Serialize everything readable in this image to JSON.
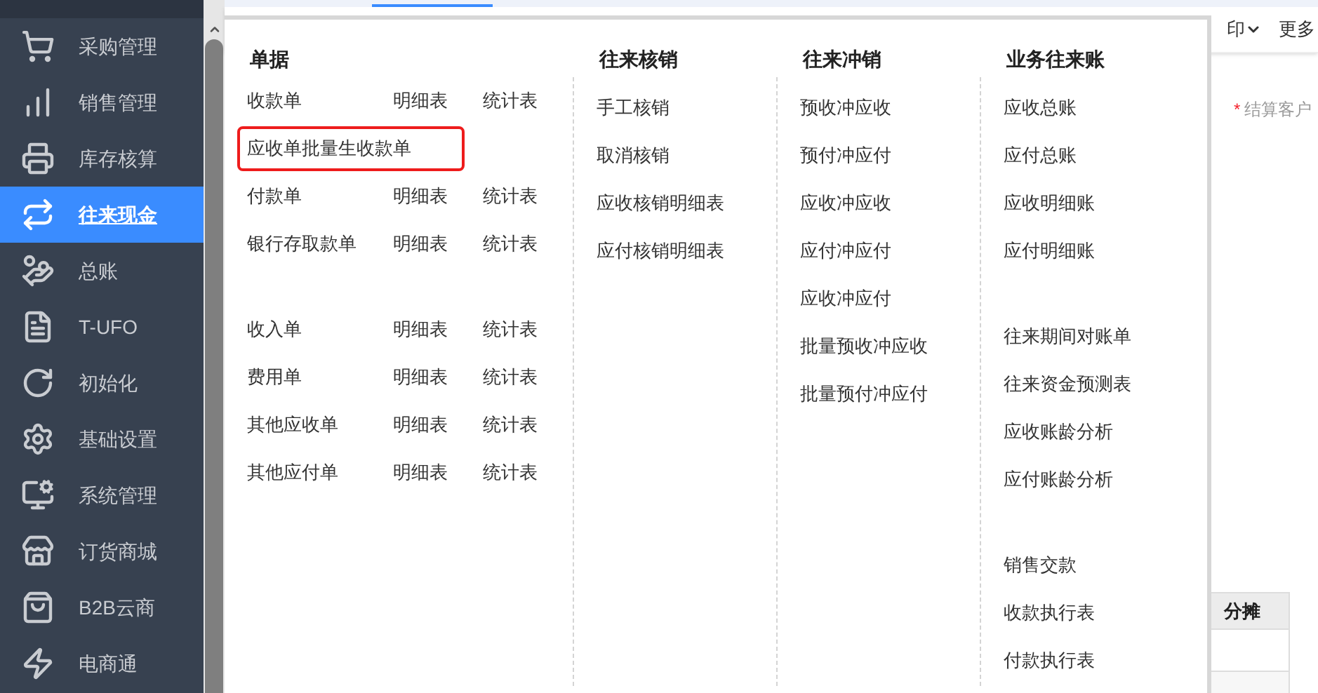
{
  "sidebar": {
    "items": [
      {
        "label": "采购管理",
        "selected": false
      },
      {
        "label": "销售管理",
        "selected": false
      },
      {
        "label": "库存核算",
        "selected": false
      },
      {
        "label": "往来现金",
        "selected": true
      },
      {
        "label": "总账",
        "selected": false
      },
      {
        "label": "T-UFO",
        "selected": false
      },
      {
        "label": "初始化",
        "selected": false
      },
      {
        "label": "基础设置",
        "selected": false
      },
      {
        "label": "系统管理",
        "selected": false
      },
      {
        "label": "订货商城",
        "selected": false
      },
      {
        "label": "B2B云商",
        "selected": false
      },
      {
        "label": "电商通",
        "selected": false
      }
    ]
  },
  "toolbar": {
    "items": [
      "印",
      "更多"
    ]
  },
  "form": {
    "label": "结算客户",
    "required_mark": "*"
  },
  "table": {
    "columns": [
      "分摊"
    ]
  },
  "menu": {
    "columns": [
      {
        "heading": "单据",
        "groups": [
          [
            {
              "cells": [
                "收款单",
                "明细表",
                "统计表"
              ],
              "highlighted": false
            },
            {
              "cells": [
                "应收单批量生收款单"
              ],
              "highlighted": true
            },
            {
              "cells": [
                "付款单",
                "明细表",
                "统计表"
              ],
              "highlighted": false
            },
            {
              "cells": [
                "银行存取款单",
                "明细表",
                "统计表"
              ],
              "highlighted": false
            }
          ],
          [
            {
              "cells": [
                "收入单",
                "明细表",
                "统计表"
              ],
              "highlighted": false
            },
            {
              "cells": [
                "费用单",
                "明细表",
                "统计表"
              ],
              "highlighted": false
            },
            {
              "cells": [
                "其他应收单",
                "明细表",
                "统计表"
              ],
              "highlighted": false
            },
            {
              "cells": [
                "其他应付单",
                "明细表",
                "统计表"
              ],
              "highlighted": false
            }
          ]
        ]
      },
      {
        "heading": "往来核销",
        "groups": [
          [
            {
              "cells": [
                "手工核销"
              ],
              "highlighted": false
            },
            {
              "cells": [
                "取消核销"
              ],
              "highlighted": false
            },
            {
              "cells": [
                "应收核销明细表"
              ],
              "highlighted": false
            },
            {
              "cells": [
                "应付核销明细表"
              ],
              "highlighted": false
            }
          ]
        ]
      },
      {
        "heading": "往来冲销",
        "groups": [
          [
            {
              "cells": [
                "预收冲应收"
              ],
              "highlighted": false
            },
            {
              "cells": [
                "预付冲应付"
              ],
              "highlighted": false
            },
            {
              "cells": [
                "应收冲应收"
              ],
              "highlighted": false
            },
            {
              "cells": [
                "应付冲应付"
              ],
              "highlighted": false
            },
            {
              "cells": [
                "应收冲应付"
              ],
              "highlighted": false
            },
            {
              "cells": [
                "批量预收冲应收"
              ],
              "highlighted": false
            },
            {
              "cells": [
                "批量预付冲应付"
              ],
              "highlighted": false
            }
          ]
        ]
      },
      {
        "heading": "业务往来账",
        "groups": [
          [
            {
              "cells": [
                "应收总账"
              ],
              "highlighted": false
            },
            {
              "cells": [
                "应付总账"
              ],
              "highlighted": false
            },
            {
              "cells": [
                "应收明细账"
              ],
              "highlighted": false
            },
            {
              "cells": [
                "应付明细账"
              ],
              "highlighted": false
            }
          ],
          [
            {
              "cells": [
                "往来期间对账单"
              ],
              "highlighted": false
            },
            {
              "cells": [
                "往来资金预测表"
              ],
              "highlighted": false
            },
            {
              "cells": [
                "应收账龄分析"
              ],
              "highlighted": false
            },
            {
              "cells": [
                "应付账龄分析"
              ],
              "highlighted": false
            }
          ],
          [
            {
              "cells": [
                "销售交款"
              ],
              "highlighted": false
            },
            {
              "cells": [
                "收款执行表"
              ],
              "highlighted": false
            },
            {
              "cells": [
                "付款执行表"
              ],
              "highlighted": false
            }
          ]
        ]
      }
    ]
  }
}
